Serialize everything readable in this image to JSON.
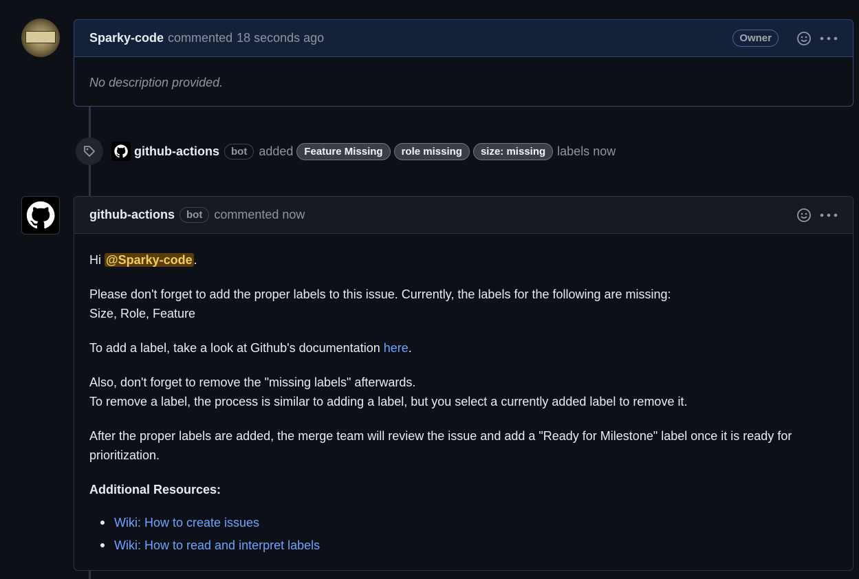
{
  "owner_comment": {
    "author": "Sparky-code",
    "action": "commented",
    "time": "18 seconds ago",
    "badge": "Owner",
    "body": "No description provided."
  },
  "event": {
    "actor": "github-actions",
    "actor_badge": "bot",
    "action": "added",
    "labels": [
      "Feature Missing",
      "role missing",
      "size: missing"
    ],
    "suffix": "labels now"
  },
  "bot_comment": {
    "author": "github-actions",
    "badge": "bot",
    "action": "commented now",
    "greeting": "Hi",
    "mention": "@Sparky-code",
    "greeting_end": ".",
    "para1_line1": "Please don't forget to add the proper labels to this issue. Currently, the labels for the following are missing:",
    "para1_line2": "Size, Role, Feature",
    "para2_text": "To add a label, take a look at Github's documentation",
    "para2_link": "here",
    "para2_end": ".",
    "para3_line1": "Also, don't forget to remove the \"missing labels\" afterwards.",
    "para3_line2": "To remove a label, the process is similar to adding a label, but you select a currently added label to remove it.",
    "para4": "After the proper labels are added, the merge team will review the issue and add a \"Ready for Milestone\" label once it is ready for prioritization.",
    "resources_heading": "Additional Resources:",
    "resources": [
      "Wiki: How to create issues",
      "Wiki: How to read and interpret labels"
    ]
  },
  "icons": {
    "reaction": "smiley-icon",
    "menu": "kebab-icon",
    "label": "tag-icon",
    "avatar_bot": "github-mark-icon"
  },
  "colors": {
    "background": "#0d1117",
    "link": "#6ea3ff",
    "mention_bg": "#5a3d0c",
    "owner_border": "#2f4a78"
  }
}
